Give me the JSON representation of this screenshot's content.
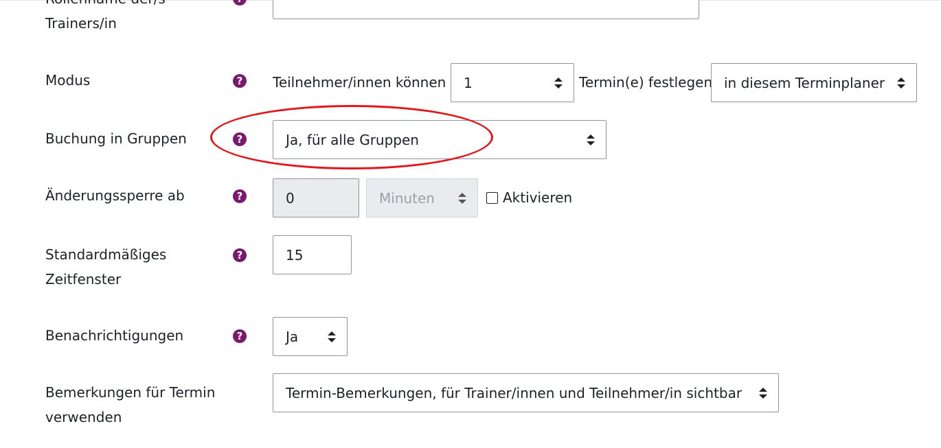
{
  "rows": {
    "trainer_role": {
      "label": "Rollenname der/s Trainers/in",
      "value": ""
    },
    "mode": {
      "label": "Modus",
      "prefix": "Teilnehmer/innen können",
      "count_value": "1",
      "middle": "Termin(e) festlegen",
      "scope_value": "in diesem Terminplaner"
    },
    "group_booking": {
      "label": "Buchung in Gruppen",
      "value": "Ja, für alle Gruppen"
    },
    "guard_time": {
      "label": "Änderungssperre ab",
      "number_value": "0",
      "unit_value": "Minuten",
      "checkbox_label": "Aktivieren",
      "checkbox_checked": false
    },
    "default_slot": {
      "label": "Standardmäßiges Zeitfenster",
      "value": "15"
    },
    "notifications": {
      "label": "Benachrichtigungen",
      "value": "Ja"
    },
    "slot_notes": {
      "label": "Bemerkungen für Termin verwenden",
      "value": "Termin-Bemerkungen, für Trainer/innen und Teilnehmer/in sichtbar"
    }
  },
  "help_icon": {
    "symbol": "?",
    "icon_name": "question-circle-icon",
    "color": "#7a1a6e"
  },
  "annotation": {
    "color": "#e0171b"
  }
}
